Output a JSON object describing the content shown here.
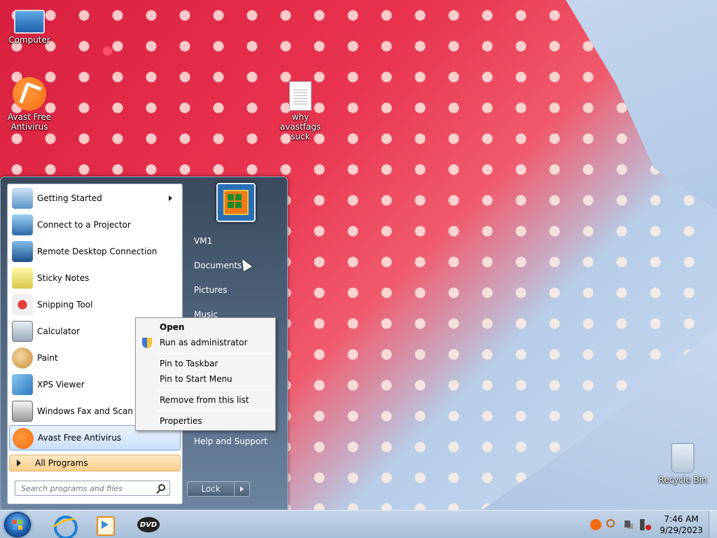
{
  "desktop": {
    "icons": [
      {
        "label": "Computer"
      },
      {
        "label": "Avast Free Antivirus"
      },
      {
        "label": "why avastfags suck"
      },
      {
        "label": "Recycle Bin"
      }
    ]
  },
  "start_menu": {
    "programs": [
      {
        "label": "Getting Started",
        "icon": "getting-started-icon"
      },
      {
        "label": "Connect to a Projector",
        "icon": "projector-icon"
      },
      {
        "label": "Remote Desktop Connection",
        "icon": "remote-desktop-icon"
      },
      {
        "label": "Sticky Notes",
        "icon": "sticky-notes-icon"
      },
      {
        "label": "Snipping Tool",
        "icon": "scissors-icon"
      },
      {
        "label": "Calculator",
        "icon": "calculator-icon"
      },
      {
        "label": "Paint",
        "icon": "paint-icon"
      },
      {
        "label": "XPS Viewer",
        "icon": "xps-viewer-icon"
      },
      {
        "label": "Windows Fax and Scan",
        "icon": "fax-icon"
      },
      {
        "label": "Avast Free Antivirus",
        "icon": "avast-icon"
      }
    ],
    "all_programs": "All Programs",
    "search_placeholder": "Search programs and files",
    "right_items": [
      "VM1",
      "Documents",
      "Pictures",
      "Music",
      "Help and Support"
    ],
    "lock_label": "Lock"
  },
  "context_menu": {
    "items": [
      "Open",
      "Run as administrator",
      "Pin to Taskbar",
      "Pin to Start Menu",
      "Remove from this list",
      "Properties"
    ]
  },
  "taskbar": {
    "dvd_label": "DVD",
    "time": "7:46 AM",
    "date": "9/29/2023"
  }
}
